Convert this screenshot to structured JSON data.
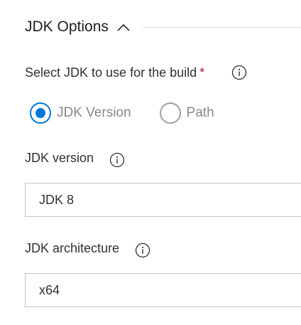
{
  "section": {
    "title": "JDK Options",
    "expanded": true,
    "chevron_icon": "chevron-up-icon"
  },
  "jdk_select": {
    "label": "Select JDK to use for the build",
    "required_marker": "*",
    "options": [
      {
        "label": "JDK Version",
        "selected": true
      },
      {
        "label": "Path",
        "selected": false
      }
    ]
  },
  "jdk_version": {
    "label": "JDK version",
    "value": "JDK 8"
  },
  "jdk_architecture": {
    "label": "JDK architecture",
    "value": "x64"
  },
  "colors": {
    "accent": "#0078d4",
    "required": "#a4262c",
    "border": "#c8c6c4",
    "muted_text": "#8a8886"
  }
}
